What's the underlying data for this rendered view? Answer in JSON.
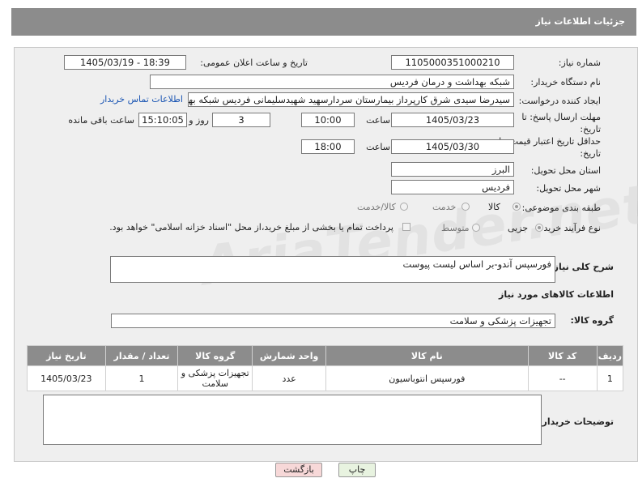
{
  "header": {
    "title": "جزئیات اطلاعات نیاز"
  },
  "fields": {
    "need_number_label": "شماره نیاز:",
    "need_number": "1105000351000210",
    "announce_label": "تاریخ و ساعت اعلان عمومی:",
    "announce_value": "1405/03/19 - 18:39",
    "buyer_org_label": "نام دستگاه خریدار:",
    "buyer_org": "شبکه بهداشت و درمان فردیس",
    "creator_label": "ایجاد کننده درخواست:",
    "creator": "سیدرضا سیدی شرق کارپرداز بیمارستان سردارسهید شهیدسلیمانی فردیس شبکه بهداشت",
    "contact_link": "اطلاعات تماس خریدار",
    "reply_deadline_label": "مهلت ارسال پاسخ: تا تاریخ:",
    "reply_date": "1405/03/23",
    "time_label": "ساعت",
    "reply_time": "10:00",
    "days": "3",
    "days_label": "روز و",
    "remaining_time": "15:10:05",
    "remaining_label": "ساعت باقی مانده",
    "price_validity_label": "حداقل تاریخ اعتبار قیمت: تا تاریخ:",
    "price_date": "1405/03/30",
    "price_time": "18:00",
    "province_label": "استان محل تحویل:",
    "province": "البرز",
    "city_label": "شهر محل تحویل:",
    "city": "فردیس",
    "category_label": "طبقه بندی موضوعی:",
    "category_options": [
      "کالا",
      "خدمت",
      "کالا/خدمت"
    ],
    "process_label": "نوع فرآیند خرید :",
    "process_options": [
      "جزیی",
      "متوسط"
    ],
    "payment_note": "پرداخت تمام یا بخشی از مبلغ خرید،از محل \"اسناد خزانه اسلامی\" خواهد بود.",
    "description_label": "شرح کلی نیاز:",
    "description": "فورسپس آندو-بر اساس لیست پیوست",
    "goods_info_title": "اطلاعات کالاهای مورد نیاز",
    "goods_group_label": "گروه کالا:",
    "goods_group": "تجهیزات پزشکی و سلامت",
    "buyer_notes_label": "توضیحات خریدار:"
  },
  "table": {
    "headers": [
      "ردیف",
      "کد کالا",
      "نام کالا",
      "واحد شمارش",
      "گروه کالا",
      "تعداد / مقدار",
      "تاریخ نیاز"
    ],
    "rows": [
      [
        "1",
        "--",
        "فورسپس انتوباسیون",
        "عدد",
        "تجهیزات پزشکی و سلامت",
        "1",
        "1405/03/23"
      ]
    ]
  },
  "buttons": {
    "print": "چاپ",
    "back": "بازگشت"
  },
  "watermark": "AriaTender.net",
  "colors": {
    "header_bg": "#8c8c8c",
    "panel_bg": "#efefef",
    "link": "#1a55b3",
    "back_button_bg": "#f7d8d8",
    "print_button_bg": "#e8f3e0"
  }
}
